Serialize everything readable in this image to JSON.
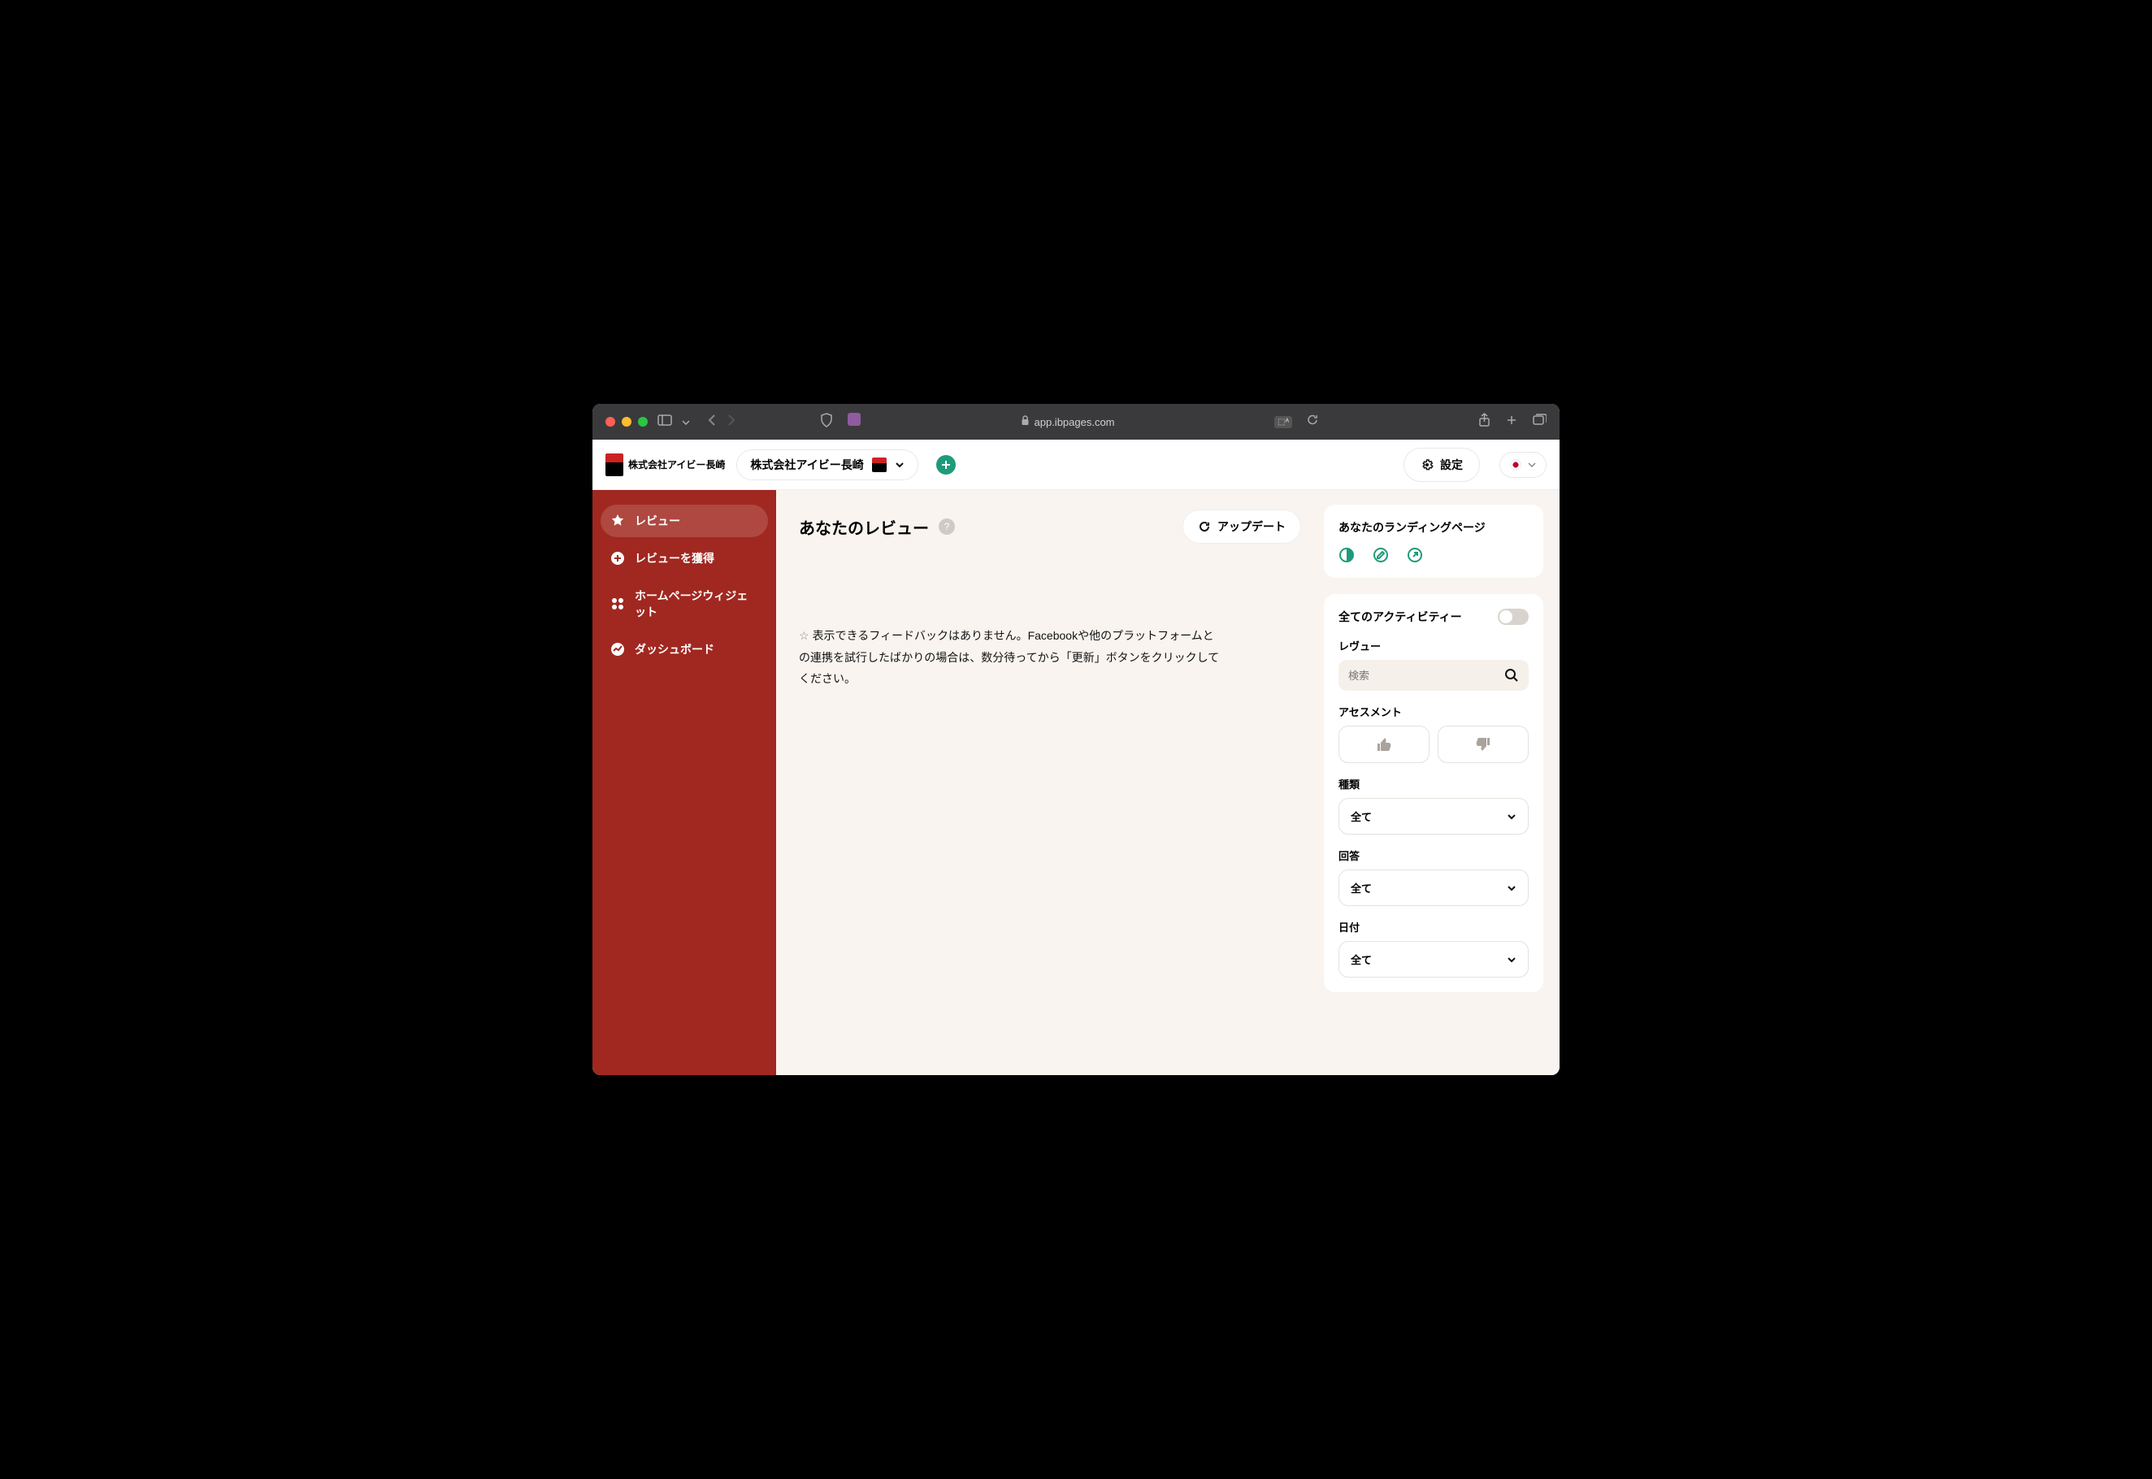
{
  "browser": {
    "url_host": "app.ibpages.com"
  },
  "header": {
    "logo_text": "株式会社アイビー長崎",
    "org_name": "株式会社アイビー長崎",
    "settings_label": "設定"
  },
  "sidebar": {
    "items": [
      {
        "label": "レビュー",
        "active": true
      },
      {
        "label": "レビューを獲得",
        "active": false
      },
      {
        "label": "ホームページウィジェット",
        "active": false
      },
      {
        "label": "ダッシュボード",
        "active": false
      }
    ]
  },
  "main": {
    "title": "あなたのレビュー",
    "update_label": "アップデート",
    "empty_message": "表示できるフィードバックはありません。Facebookや他のプラットフォームとの連携を試行したばかりの場合は、数分待ってから「更新」ボタンをクリックしてください。"
  },
  "right": {
    "landing_title": "あなたのランディングページ",
    "activity_title": "全てのアクティビティー",
    "review_label": "レヴュー",
    "search_placeholder": "検索",
    "assessment_label": "アセスメント",
    "type_label": "種類",
    "type_value": "全て",
    "answer_label": "回答",
    "answer_value": "全て",
    "date_label": "日付",
    "date_value": "全て"
  }
}
